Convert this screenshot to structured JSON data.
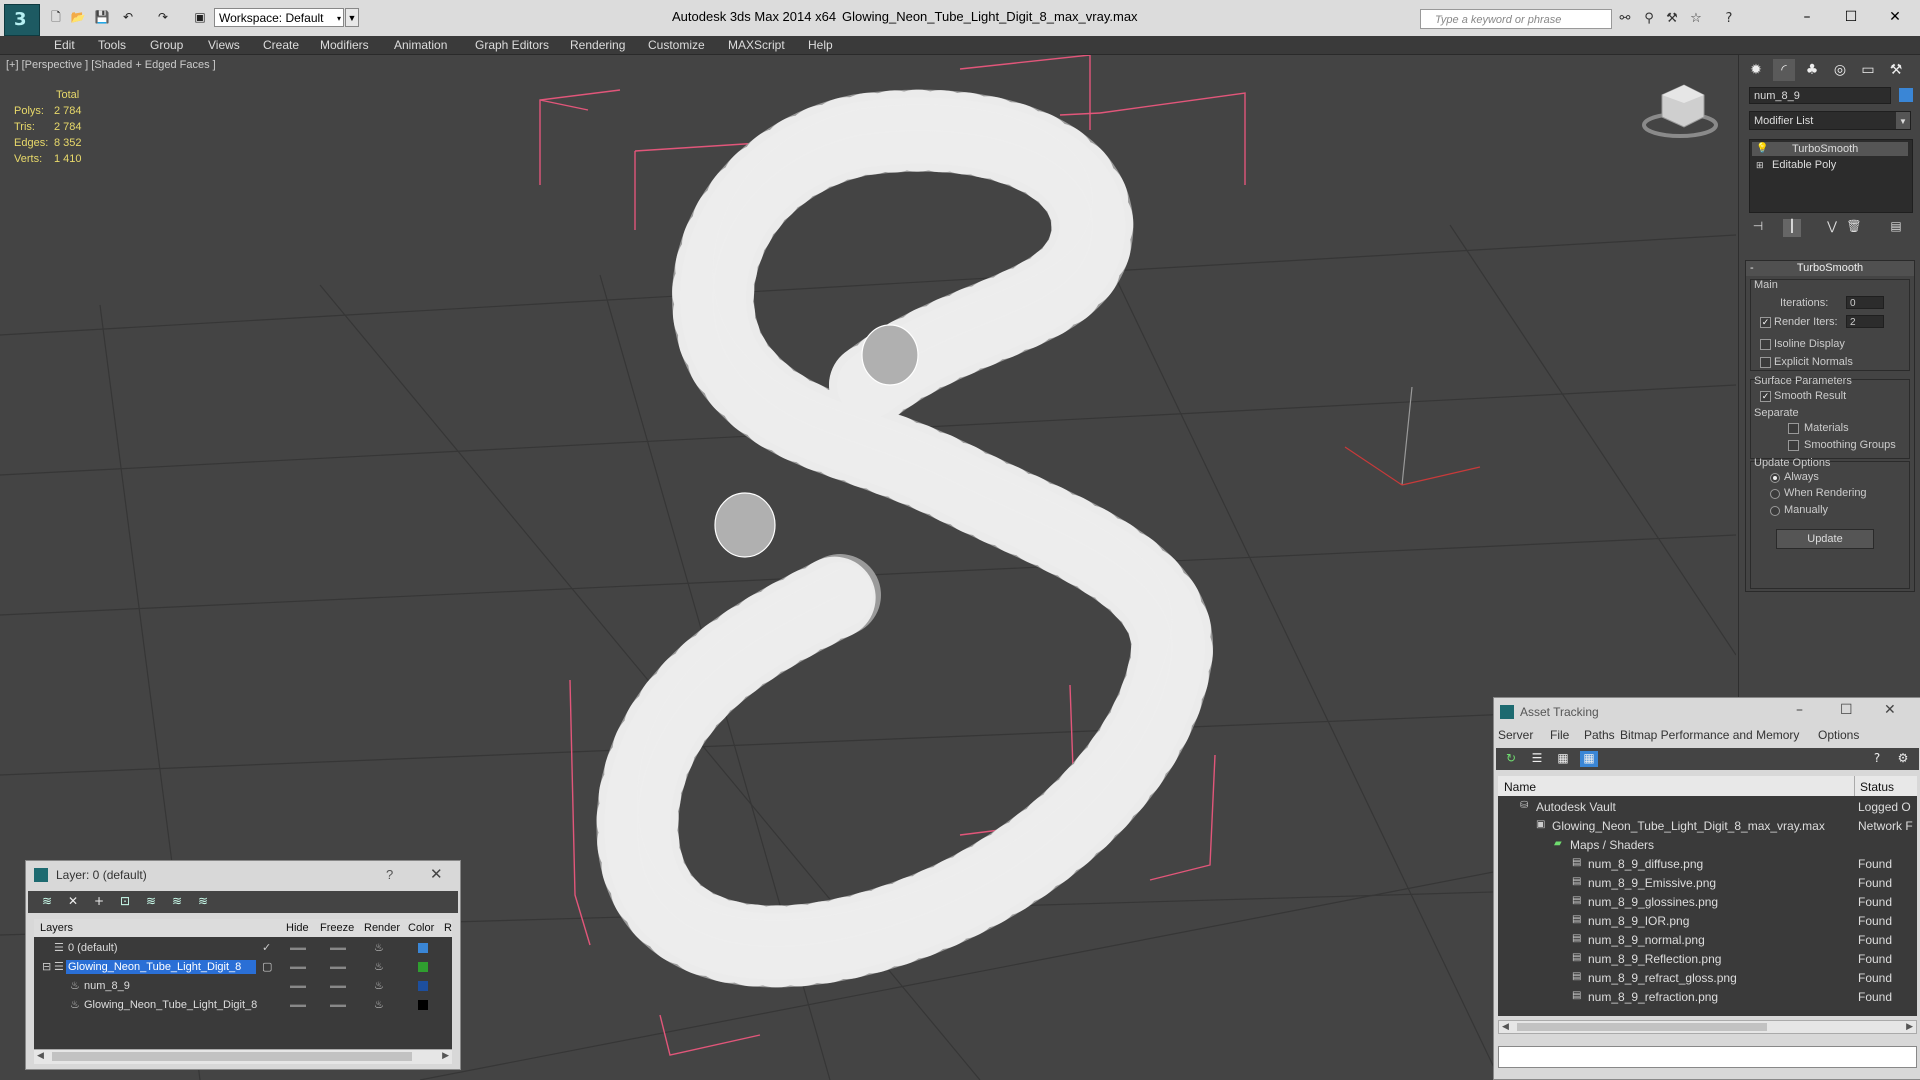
{
  "titlebar": {
    "workspace": "Workspace: Default",
    "app_title": "Autodesk 3ds Max  2014 x64",
    "file_title": "Glowing_Neon_Tube_Light_Digit_8_max_vray.max",
    "search_placeholder": "Type a keyword or phrase"
  },
  "menu": [
    "Edit",
    "Tools",
    "Group",
    "Views",
    "Create",
    "Modifiers",
    "Animation",
    "Graph Editors",
    "Rendering",
    "Customize",
    "MAXScript",
    "Help"
  ],
  "viewport": {
    "label": "[+] [Perspective ] [Shaded + Edged Faces ]",
    "stats": {
      "header": "Total",
      "rows": [
        {
          "k": "Polys:",
          "v": "2 784"
        },
        {
          "k": "Tris:",
          "v": "2 784"
        },
        {
          "k": "Edges:",
          "v": "8 352"
        },
        {
          "k": "Verts:",
          "v": "1 410"
        }
      ]
    },
    "colors": {
      "bbox": "#e2567a",
      "mesh": "#c8c8c8",
      "grid": "#363636",
      "wire": "#ffffff"
    }
  },
  "command_panel": {
    "object_name": "num_8_9",
    "object_color": "#3a86d6",
    "modifier_list": "Modifier List",
    "stack": [
      "TurboSmooth",
      "Editable Poly"
    ],
    "rollout_title": "TurboSmooth",
    "main_label": "Main",
    "iterations_label": "Iterations:",
    "iterations_value": "0",
    "render_iters_label": "Render Iters:",
    "render_iters_value": "2",
    "isoline": "Isoline Display",
    "explicit_normals": "Explicit Normals",
    "surface_params": "Surface Parameters",
    "smooth_result": "Smooth Result",
    "separate": "Separate",
    "materials": "Materials",
    "smoothing_groups": "Smoothing Groups",
    "update_options": "Update Options",
    "always": "Always",
    "when_rendering": "When Rendering",
    "manually": "Manually",
    "update_btn": "Update"
  },
  "layer_dialog": {
    "title": "Layer: 0 (default)",
    "help": "?",
    "columns": [
      "Layers",
      "Hide",
      "Freeze",
      "Render",
      "Color",
      "R"
    ],
    "rows": [
      {
        "name": "0 (default)",
        "color": "#3a86d6",
        "check": "✓"
      },
      {
        "name": "Glowing_Neon_Tube_Light_Digit_8",
        "color": "#2f9e2f",
        "selected": true
      },
      {
        "name": "num_8_9",
        "color": "#1d4f9e"
      },
      {
        "name": "Glowing_Neon_Tube_Light_Digit_8",
        "color": "#000000"
      }
    ]
  },
  "asset_tracking": {
    "title": "Asset Tracking",
    "menu": [
      "Server",
      "File",
      "Paths",
      "Bitmap Performance and Memory",
      "Options"
    ],
    "columns": [
      "Name",
      "Status"
    ],
    "rows": [
      {
        "name": "Autodesk Vault",
        "status": "Logged O",
        "indent": 0
      },
      {
        "name": "Glowing_Neon_Tube_Light_Digit_8_max_vray.max",
        "status": "Network F",
        "indent": 1
      },
      {
        "name": "Maps / Shaders",
        "status": "",
        "indent": 2
      },
      {
        "name": "num_8_9_diffuse.png",
        "status": "Found",
        "indent": 3
      },
      {
        "name": "num_8_9_Emissive.png",
        "status": "Found",
        "indent": 3
      },
      {
        "name": "num_8_9_glossines.png",
        "status": "Found",
        "indent": 3
      },
      {
        "name": "num_8_9_IOR.png",
        "status": "Found",
        "indent": 3
      },
      {
        "name": "num_8_9_normal.png",
        "status": "Found",
        "indent": 3
      },
      {
        "name": "num_8_9_Reflection.png",
        "status": "Found",
        "indent": 3
      },
      {
        "name": "num_8_9_refract_gloss.png",
        "status": "Found",
        "indent": 3
      },
      {
        "name": "num_8_9_refraction.png",
        "status": "Found",
        "indent": 3
      }
    ]
  }
}
